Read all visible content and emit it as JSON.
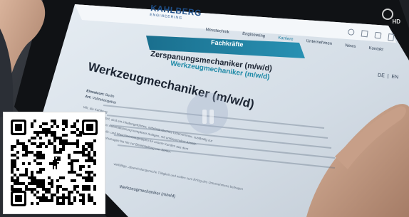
{
  "photo": {
    "subject": "Hand holding a tablet showing a job listing webpage",
    "hd_badge": "HD"
  },
  "website": {
    "logo": {
      "name_line1": "KAHLBERG",
      "name_line2": "ENGINEERING"
    },
    "nav": {
      "items": [
        "Messtechnik",
        "Engineering",
        "Karriere",
        "Unternehmen",
        "News",
        "Kontakt"
      ],
      "active": "Karriere"
    },
    "lang": {
      "de": "DE",
      "sep": "|",
      "en": "EN"
    },
    "banner": {
      "text": "Fachkräfte"
    },
    "section": {
      "title": "Zerspanungsmechaniker (m/w/d)",
      "subtitle": "Werkzeugmechaniker (m/w/d)"
    },
    "job": {
      "title": "Werkzeugmechaniker (m/w/d)",
      "einsatzort_label": "Einsatzort:",
      "einsatzort_value": "Berlin",
      "art_label": "Art:",
      "art_value": "Vollzeitangebot",
      "intro_lines": [
        "Wir, die Kahlberg",
        "Messtechnik GmbH, sind ein inhabergeführtes, mittelständisches Unternehmen, zuständig zur",
        "Fertigung sowie der Automatisierung komplexer Anlagen, mit umfassendem Ansatz.",
        "Entwicklung der Teile- und Maschinenbaugruppen für unsere Kunden aus dem",
        "Hilfe- und Sonderwerkzeugen bis hin zur Bereitstellung von Serien."
      ],
      "footer_line": "Werkzeugmechaniker (m/w/d)",
      "extra_line": "vielfältige, abwechslungsreiche Tätigkeit und wollen zum Erfolg des Unternehmens beitragen"
    },
    "toolbar_icons": [
      "share-icon",
      "grid-icon",
      "settings-icon",
      "bookmark-icon"
    ]
  },
  "qr_code": {
    "center_icon": "dinosaur-icon"
  },
  "colors": {
    "banner": "#1f7fa0",
    "nav_text": "#2e3e52",
    "title_text": "#1b2432",
    "screen_bg": "#d9e2ea"
  }
}
